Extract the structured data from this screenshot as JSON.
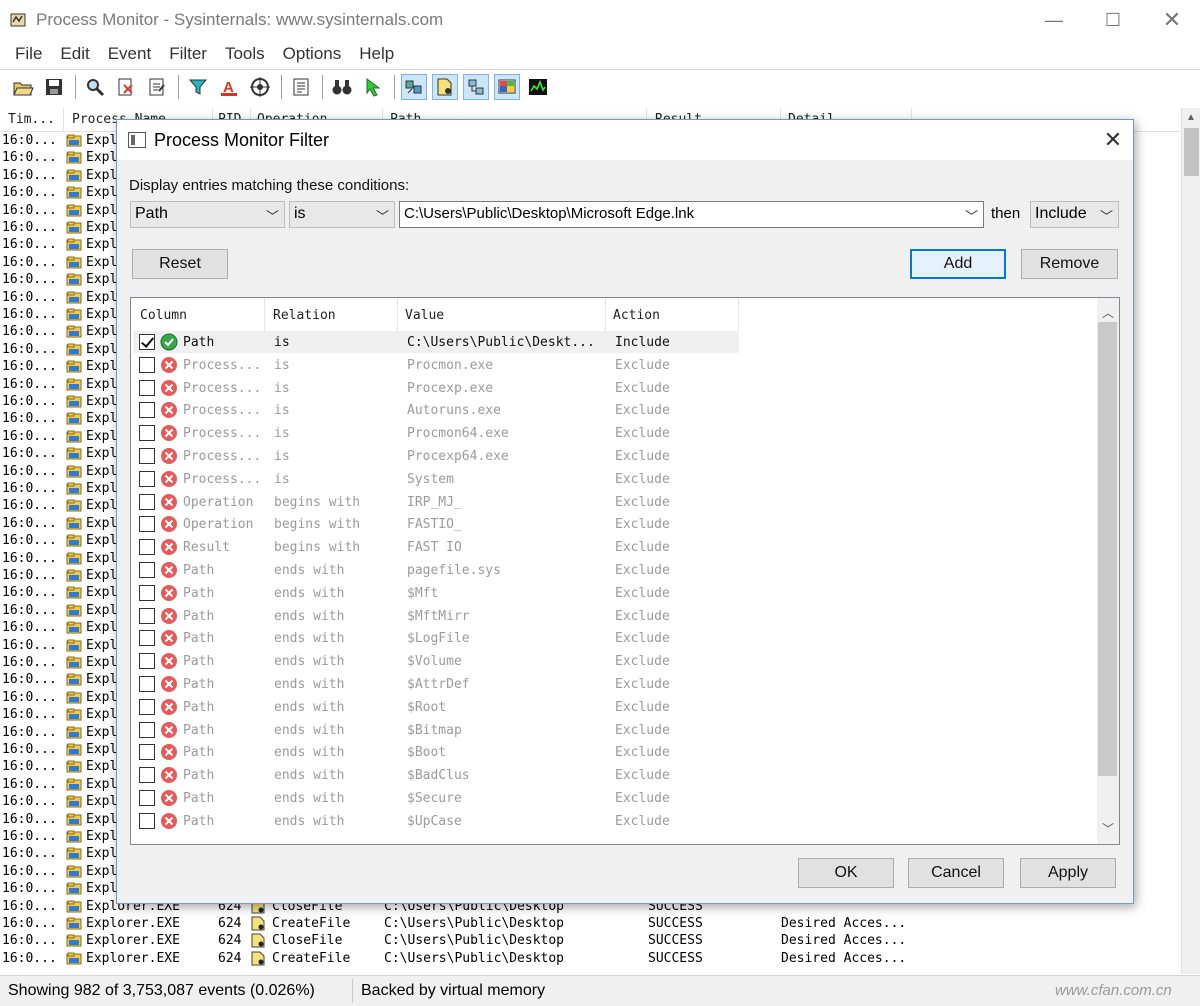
{
  "window": {
    "title": "Process Monitor - Sysinternals: www.sysinternals.com",
    "controls": {
      "minimize": "—",
      "maximize": "☐",
      "close": "✕"
    }
  },
  "menu": [
    "File",
    "Edit",
    "Event",
    "Filter",
    "Tools",
    "Options",
    "Help"
  ],
  "toolbar": {
    "icons": [
      "open-icon",
      "save-icon",
      "search-icon",
      "clear-icon",
      "autoscroll-icon",
      "filter-icon",
      "highlight-icon",
      "target-icon",
      "jump-icon",
      "find-icon",
      "jump-to-icon",
      "registry-activity-icon",
      "file-activity-icon",
      "network-activity-icon",
      "process-activity-icon",
      "profiling-icon"
    ]
  },
  "event_list": {
    "headers": [
      "Tim...",
      "Process Name",
      "PID",
      "Operation",
      "Path",
      "Result",
      "Detail"
    ],
    "time_prefix": "16:0...",
    "process_prefix": "Expl",
    "full_rows": [
      {
        "time": "16:0...",
        "process": "Explorer.EXE",
        "pid": "624",
        "operation": "CloseFile",
        "path": "C:\\Users\\Public\\Desktop",
        "result": "SUCCESS",
        "detail": ""
      },
      {
        "time": "16:0...",
        "process": "Explorer.EXE",
        "pid": "624",
        "operation": "CreateFile",
        "path": "C:\\Users\\Public\\Desktop",
        "result": "SUCCESS",
        "detail": "Desired Acces..."
      },
      {
        "time": "16:0...",
        "process": "Explorer.EXE",
        "pid": "624",
        "operation": "CloseFile",
        "path": "C:\\Users\\Public\\Desktop",
        "result": "SUCCESS",
        "detail": "Desired Acces..."
      },
      {
        "time": "16:0...",
        "process": "Explorer.EXE",
        "pid": "624",
        "operation": "CreateFile",
        "path": "C:\\Users\\Public\\Desktop",
        "result": "SUCCESS",
        "detail": "Desired Acces..."
      }
    ]
  },
  "status": {
    "events": "Showing 982 of 3,753,087 events (0.026%)",
    "memory": "Backed by virtual memory",
    "watermark": "www.cfan.com.cn"
  },
  "dialog": {
    "title": "Process Monitor Filter",
    "close": "✕",
    "conditions_label": "Display entries matching these conditions:",
    "column_combo": "Path",
    "relation_combo": "is",
    "value_combo": "C:\\Users\\Public\\Desktop\\Microsoft Edge.lnk",
    "then_label": "then",
    "action_combo": "Include",
    "reset_label": "Reset",
    "add_label": "Add",
    "remove_label": "Remove",
    "ok_label": "OK",
    "cancel_label": "Cancel",
    "apply_label": "Apply",
    "list_headers": [
      "Column",
      "Relation",
      "Value",
      "Action"
    ],
    "rules": [
      {
        "checked": true,
        "status": "include",
        "column": "Path",
        "relation": "is",
        "value": "C:\\Users\\Public\\Deskt...",
        "action": "Include"
      },
      {
        "checked": false,
        "status": "exclude",
        "column": "Process...",
        "relation": "is",
        "value": "Procmon.exe",
        "action": "Exclude"
      },
      {
        "checked": false,
        "status": "exclude",
        "column": "Process...",
        "relation": "is",
        "value": "Procexp.exe",
        "action": "Exclude"
      },
      {
        "checked": false,
        "status": "exclude",
        "column": "Process...",
        "relation": "is",
        "value": "Autoruns.exe",
        "action": "Exclude"
      },
      {
        "checked": false,
        "status": "exclude",
        "column": "Process...",
        "relation": "is",
        "value": "Procmon64.exe",
        "action": "Exclude"
      },
      {
        "checked": false,
        "status": "exclude",
        "column": "Process...",
        "relation": "is",
        "value": "Procexp64.exe",
        "action": "Exclude"
      },
      {
        "checked": false,
        "status": "exclude",
        "column": "Process...",
        "relation": "is",
        "value": "System",
        "action": "Exclude"
      },
      {
        "checked": false,
        "status": "exclude",
        "column": "Operation",
        "relation": "begins with",
        "value": "IRP_MJ_",
        "action": "Exclude"
      },
      {
        "checked": false,
        "status": "exclude",
        "column": "Operation",
        "relation": "begins with",
        "value": "FASTIO_",
        "action": "Exclude"
      },
      {
        "checked": false,
        "status": "exclude",
        "column": "Result",
        "relation": "begins with",
        "value": "FAST IO",
        "action": "Exclude"
      },
      {
        "checked": false,
        "status": "exclude",
        "column": "Path",
        "relation": "ends with",
        "value": "pagefile.sys",
        "action": "Exclude"
      },
      {
        "checked": false,
        "status": "exclude",
        "column": "Path",
        "relation": "ends with",
        "value": "$Mft",
        "action": "Exclude"
      },
      {
        "checked": false,
        "status": "exclude",
        "column": "Path",
        "relation": "ends with",
        "value": "$MftMirr",
        "action": "Exclude"
      },
      {
        "checked": false,
        "status": "exclude",
        "column": "Path",
        "relation": "ends with",
        "value": "$LogFile",
        "action": "Exclude"
      },
      {
        "checked": false,
        "status": "exclude",
        "column": "Path",
        "relation": "ends with",
        "value": "$Volume",
        "action": "Exclude"
      },
      {
        "checked": false,
        "status": "exclude",
        "column": "Path",
        "relation": "ends with",
        "value": "$AttrDef",
        "action": "Exclude"
      },
      {
        "checked": false,
        "status": "exclude",
        "column": "Path",
        "relation": "ends with",
        "value": "$Root",
        "action": "Exclude"
      },
      {
        "checked": false,
        "status": "exclude",
        "column": "Path",
        "relation": "ends with",
        "value": "$Bitmap",
        "action": "Exclude"
      },
      {
        "checked": false,
        "status": "exclude",
        "column": "Path",
        "relation": "ends with",
        "value": "$Boot",
        "action": "Exclude"
      },
      {
        "checked": false,
        "status": "exclude",
        "column": "Path",
        "relation": "ends with",
        "value": "$BadClus",
        "action": "Exclude"
      },
      {
        "checked": false,
        "status": "exclude",
        "column": "Path",
        "relation": "ends with",
        "value": "$Secure",
        "action": "Exclude"
      },
      {
        "checked": false,
        "status": "exclude",
        "column": "Path",
        "relation": "ends with",
        "value": "$UpCase",
        "action": "Exclude"
      }
    ]
  },
  "colors": {
    "include_icon": "#3aa84a",
    "exclude_icon": "#e85a5a",
    "default_button_border": "#0078d7",
    "dialog_background": "#f0f0f0"
  }
}
